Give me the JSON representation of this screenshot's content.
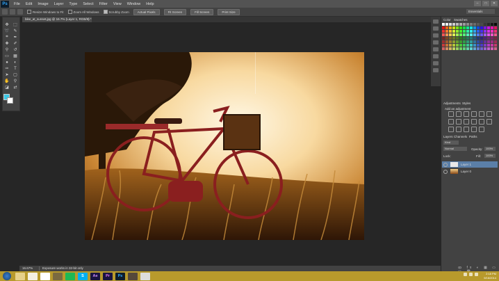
{
  "app": {
    "logo_text": "Ps"
  },
  "menu": [
    "File",
    "Edit",
    "Image",
    "Layer",
    "Type",
    "Select",
    "Filter",
    "View",
    "Window",
    "Help"
  ],
  "window_controls": [
    "–",
    "□",
    "✕"
  ],
  "options_bar": {
    "checks": [
      "Resize Windows to Fit",
      "Zoom All Windows",
      "Scrubby Zoom"
    ],
    "buttons": [
      "Actual Pixels",
      "Fit Screen",
      "Fill Screen",
      "Print Size"
    ],
    "workspace": "Essentials"
  },
  "document": {
    "tab_title": "bike_at_sunset.jpg @ 16.7% (Layer 1, RGB/8) *",
    "zoom": "16.67%",
    "status": "Exposure works in 32-bit only"
  },
  "panels": {
    "swatches": {
      "tabs": [
        "Color",
        "Swatches"
      ]
    },
    "adjustments": {
      "tabs": [
        "Adjustments",
        "Styles"
      ],
      "title": "Add an adjustment"
    },
    "layers": {
      "tabs": [
        "Layers",
        "Channels",
        "Paths"
      ],
      "kind": "Kind",
      "blend_mode": "Normal",
      "opacity_label": "Opacity:",
      "opacity": "100%",
      "lock_label": "Lock:",
      "fill_label": "Fill:",
      "fill": "100%",
      "items": [
        {
          "name": "Layer 1",
          "selected": true
        },
        {
          "name": "Layer 0",
          "selected": false
        }
      ],
      "bottom_icons": "ꝏ fx ◐ ▦ ▭ ▢ 🗑"
    }
  },
  "taskbar": {
    "apps": [
      {
        "name": "folder",
        "label": "",
        "bg": "#e7d18a",
        "fg": "#6a5010"
      },
      {
        "name": "notes",
        "label": "",
        "bg": "#f4f0e2",
        "fg": "#333"
      },
      {
        "name": "chrome",
        "label": "",
        "bg": "#ffffff",
        "fg": "#333"
      },
      {
        "name": "utility",
        "label": "",
        "bg": "#7a6a40",
        "fg": "#fff"
      },
      {
        "name": "spotify",
        "label": "",
        "bg": "#1db954",
        "fg": "#fff"
      },
      {
        "name": "skype",
        "label": "S",
        "bg": "#00aff0",
        "fg": "#fff"
      },
      {
        "name": "after-effects",
        "label": "Ae",
        "bg": "#1a1440",
        "fg": "#d291ff"
      },
      {
        "name": "premiere",
        "label": "Pr",
        "bg": "#1a1440",
        "fg": "#e77bff"
      },
      {
        "name": "photoshop",
        "label": "Ps",
        "bg": "#0e1d2b",
        "fg": "#31a8ff"
      },
      {
        "name": "media",
        "label": "",
        "bg": "#55483a",
        "fg": "#fff"
      },
      {
        "name": "camera",
        "label": "",
        "bg": "#ddd",
        "fg": "#333"
      }
    ],
    "time": "2:18 PM",
    "date": "9/16/2014"
  }
}
